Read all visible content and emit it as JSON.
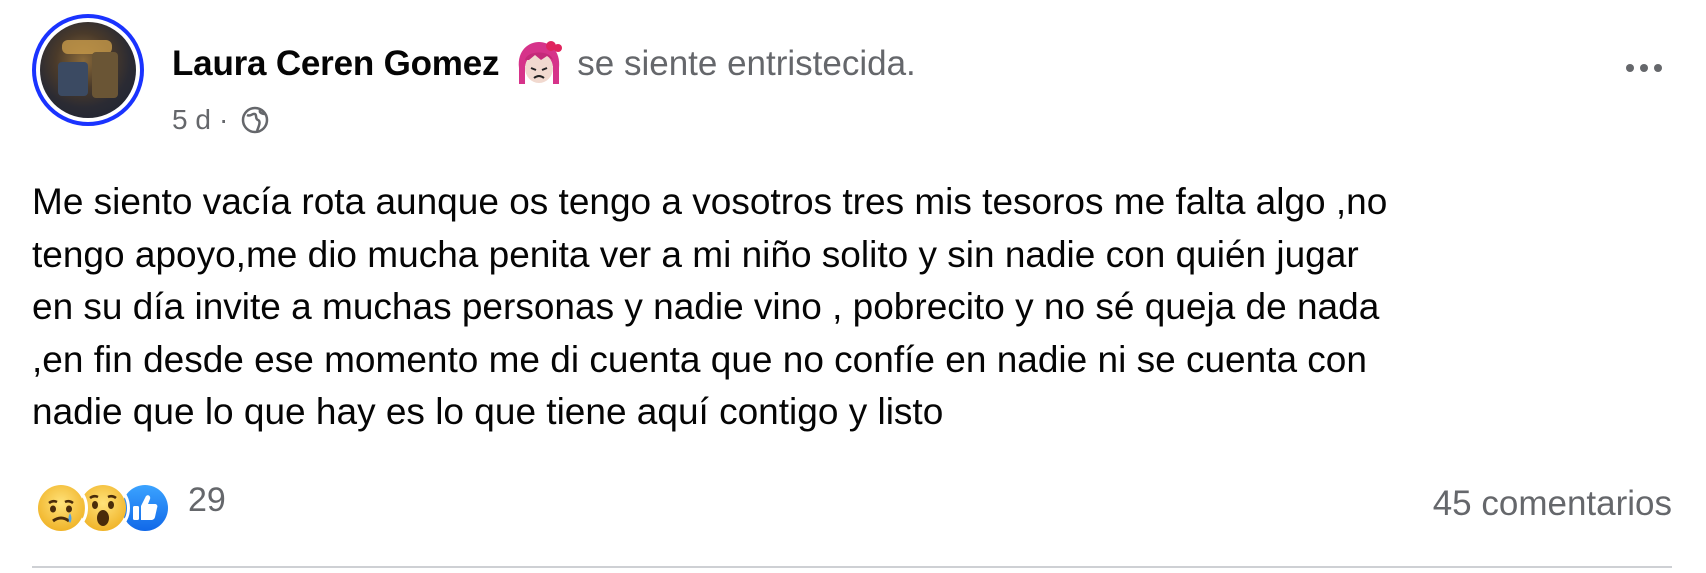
{
  "post": {
    "author_name": "Laura Ceren Gomez",
    "feeling": "se siente entristecida.",
    "timestamp": "5 d",
    "separator": "·",
    "privacy_icon": "globe-icon",
    "feeling_icon": "sad-face-sticker-icon",
    "more_icon": "more-options-icon",
    "text_lines": [
      "Me siento vacía rota aunque os tengo a vosotros tres mis tesoros me falta algo ,no",
      "tengo apoyo,me dio mucha penita ver a mi niño solito y sin nadie con quién jugar",
      "en su día invite a muchas personas y nadie vino , pobrecito y no sé queja de nada",
      ",en fin desde ese momento me di cuenta que no confíe en nadie ni se cuenta con",
      "nadie que lo que hay es lo que tiene aquí contigo y listo"
    ]
  },
  "footer": {
    "reactions": [
      "sad-reaction-icon",
      "wow-reaction-icon",
      "like-reaction-icon"
    ],
    "reactions_count": "29",
    "comments": "45 comentarios"
  },
  "colors": {
    "avatar_border": "#1a33ff",
    "secondary_text": "#65676b",
    "like_blue": "#1877f2",
    "reaction_yellow": "#f7c442"
  }
}
